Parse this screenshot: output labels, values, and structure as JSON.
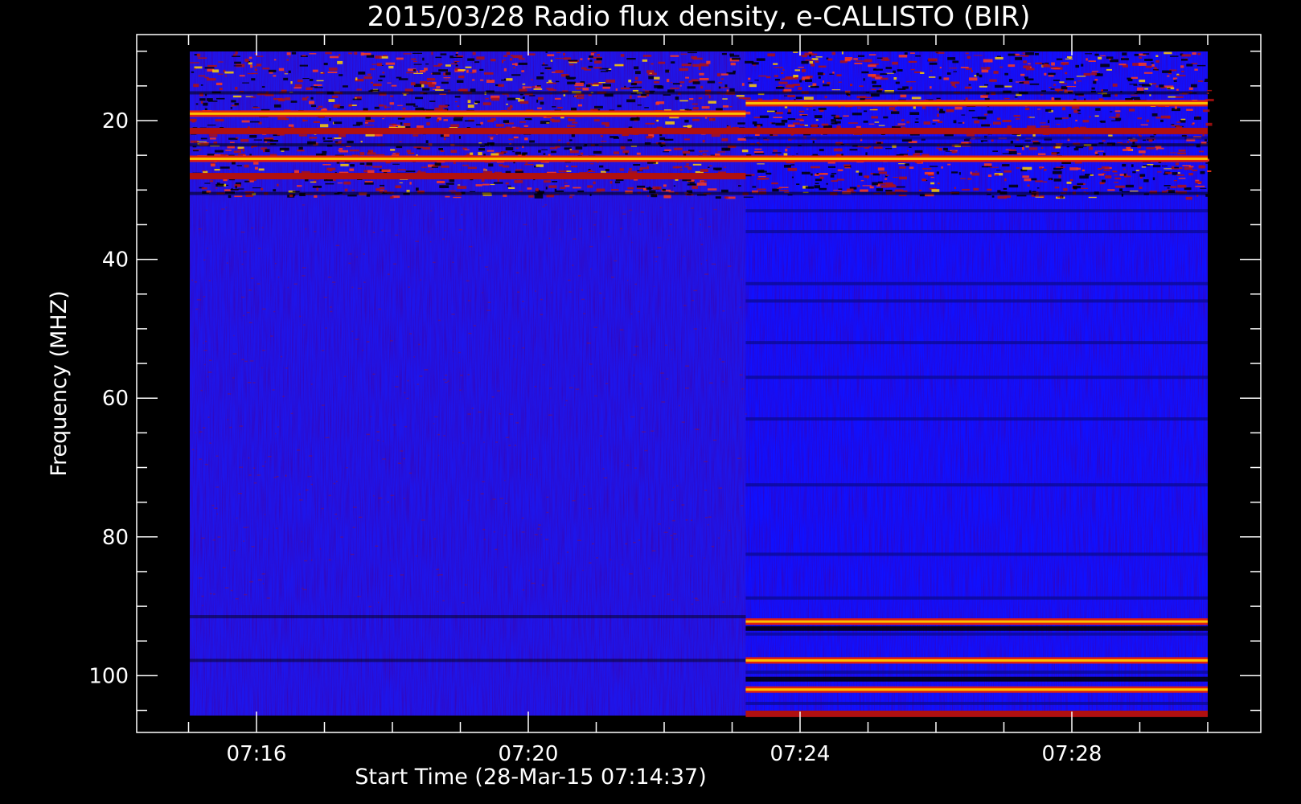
{
  "chart_data": {
    "type": "heatmap",
    "title": "2015/03/28  Radio flux density, e-CALLISTO (BIR)",
    "xlabel": "Start Time (28-Mar-15 07:14:37)",
    "ylabel": "Frequency (MHZ)",
    "x_tick_labels": [
      "07:16",
      "07:20",
      "07:24",
      "07:28"
    ],
    "y_tick_labels": [
      "20",
      "40",
      "60",
      "80",
      "100"
    ],
    "y_axis_inverted": true,
    "ylim": [
      10,
      106
    ],
    "x_minutes_range": [
      14.62,
      30.0
    ],
    "colors": {
      "background": "#000000",
      "axis": "#ffffff",
      "low": "#1010ff",
      "mid": "#b01010",
      "high": "#ffd000",
      "dark": "#000000"
    },
    "regimes": [
      {
        "start_minute": 14.62,
        "end_minute": 23.2,
        "state": "quiet"
      },
      {
        "start_minute": 23.2,
        "end_minute": 30.0,
        "state": "active"
      }
    ],
    "emission_bands": [
      {
        "freq_mhz": 19,
        "segment": "early",
        "intensity": "high"
      },
      {
        "freq_mhz": 17.5,
        "segment": "late",
        "intensity": "high"
      },
      {
        "freq_mhz": 21.5,
        "segment": "all",
        "intensity": "mid"
      },
      {
        "freq_mhz": 25.5,
        "segment": "all",
        "intensity": "high"
      },
      {
        "freq_mhz": 28,
        "segment": "early",
        "intensity": "mid"
      },
      {
        "freq_mhz": 92.2,
        "segment": "late",
        "intensity": "high"
      },
      {
        "freq_mhz": 97.8,
        "segment": "late",
        "intensity": "high"
      },
      {
        "freq_mhz": 102,
        "segment": "late",
        "intensity": "high"
      },
      {
        "freq_mhz": 105.5,
        "segment": "late",
        "intensity": "mid"
      }
    ]
  }
}
